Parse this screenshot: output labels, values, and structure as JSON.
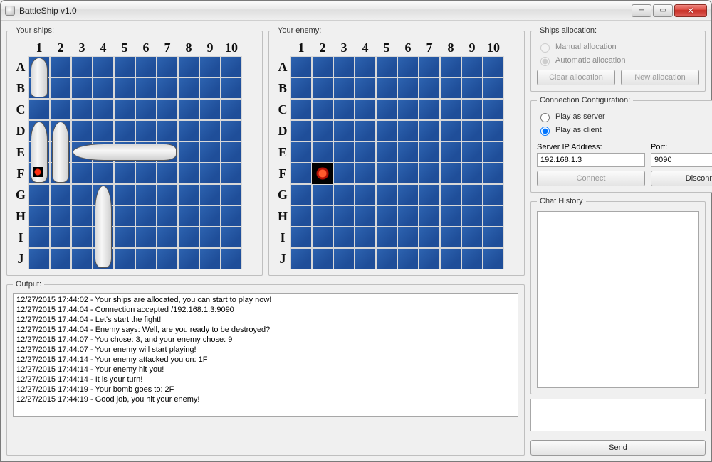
{
  "window": {
    "title": "BattleShip v1.0"
  },
  "grid": {
    "cols": [
      "1",
      "2",
      "3",
      "4",
      "5",
      "6",
      "7",
      "8",
      "9",
      "10"
    ],
    "rows": [
      "A",
      "B",
      "C",
      "D",
      "E",
      "F",
      "G",
      "H",
      "I",
      "J"
    ]
  },
  "player_board": {
    "legend": "Your ships:",
    "ships": [
      {
        "orient": "v",
        "col": 1,
        "row": 0,
        "len": 2
      },
      {
        "orient": "v",
        "col": 1,
        "row": 3,
        "len": 3
      },
      {
        "orient": "v",
        "col": 2,
        "row": 3,
        "len": 3
      },
      {
        "orient": "h",
        "col": 3,
        "row": 4,
        "len": 5
      },
      {
        "orient": "v",
        "col": 4,
        "row": 6,
        "len": 4
      }
    ],
    "hits_on_me": [
      {
        "col": 1,
        "row": 5
      }
    ]
  },
  "enemy_board": {
    "legend": "Your enemy:",
    "my_hits": [
      {
        "col": 2,
        "row": 5
      }
    ]
  },
  "ships_alloc": {
    "legend": "Ships allocation:",
    "manual_label": "Manual allocation",
    "auto_label": "Automatic allocation",
    "auto_selected": true,
    "clear_btn": "Clear allocation",
    "new_btn": "New allocation"
  },
  "conn": {
    "legend": "Connection Configuration:",
    "server_label": "Play as server",
    "client_label": "Play as client",
    "client_selected": true,
    "ip_label": "Server IP Address:",
    "port_label": "Port:",
    "ip_value": "192.168.1.3",
    "port_value": "9090",
    "connect_btn": "Connect",
    "disconnect_btn": "Disconnect"
  },
  "chat": {
    "legend": "Chat History",
    "send_btn": "Send"
  },
  "output": {
    "legend": "Output:",
    "lines": [
      "12/27/2015 17:44:02 - Your ships are allocated, you can start to play now!",
      "12/27/2015 17:44:04 - Connection accepted /192.168.1.3:9090",
      "12/27/2015 17:44:04 - Let's start the fight!",
      "12/27/2015 17:44:04 - Enemy says: Well, are you ready to be destroyed?",
      "12/27/2015 17:44:07 - You chose: 3, and your enemy chose: 9",
      "12/27/2015 17:44:07 - Your enemy will start playing!",
      "12/27/2015 17:44:14 - Your enemy attacked you on: 1F",
      "12/27/2015 17:44:14 - Your enemy hit you!",
      "12/27/2015 17:44:14 - It is your turn!",
      "12/27/2015 17:44:19 - Your bomb goes to: 2F",
      "12/27/2015 17:44:19 - Good job, you hit your enemy!"
    ]
  }
}
